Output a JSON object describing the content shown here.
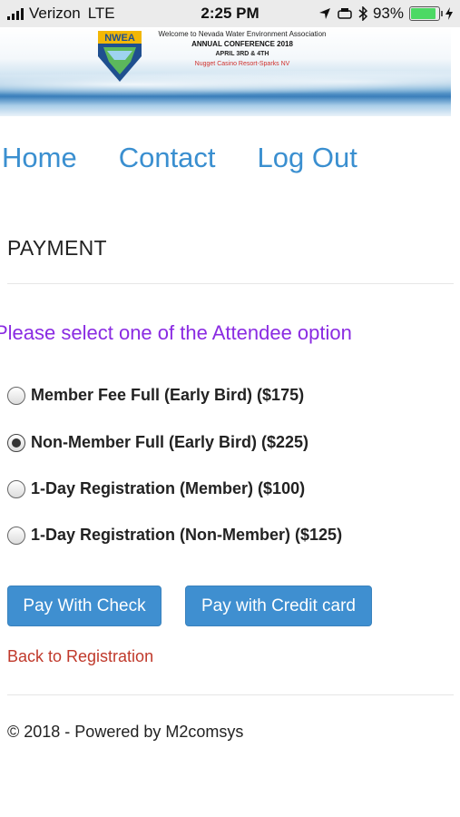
{
  "status_bar": {
    "carrier": "Verizon",
    "network": "LTE",
    "time": "2:25 PM",
    "battery": "93%",
    "icons": [
      "signal-icon",
      "location-icon",
      "alarm-icon",
      "bluetooth-icon",
      "battery-icon",
      "charging-icon"
    ]
  },
  "banner": {
    "logo_text": "NWEA",
    "line1": "Welcome to Nevada Water Environment Association",
    "line2": "ANNUAL CONFERENCE 2018",
    "line3": "APRIL 3RD & 4TH",
    "line4": "Nugget Casino Resort-Sparks NV"
  },
  "nav": {
    "home": "Home",
    "contact": "Contact",
    "logout": "Log Out"
  },
  "page": {
    "title": "PAYMENT",
    "prompt": "Please select one of the Attendee option"
  },
  "options": [
    {
      "label": "Member Fee Full (Early Bird) ($175)",
      "checked": false
    },
    {
      "label": "Non-Member Full (Early Bird) ($225)",
      "checked": true
    },
    {
      "label": "1-Day Registration (Member) ($100)",
      "checked": false
    },
    {
      "label": "1-Day Registration (Non-Member) ($125)",
      "checked": false
    }
  ],
  "buttons": {
    "check": "Pay With Check",
    "card": "Pay with Credit card"
  },
  "links": {
    "back": "Back to Registration"
  },
  "footer": {
    "text": "© 2018 - Powered by M2comsys"
  },
  "colors": {
    "link_blue": "#3a8fd0",
    "prompt_purple": "#8a2be2",
    "button_blue": "#3f8fd0",
    "back_red": "#c0392b"
  }
}
